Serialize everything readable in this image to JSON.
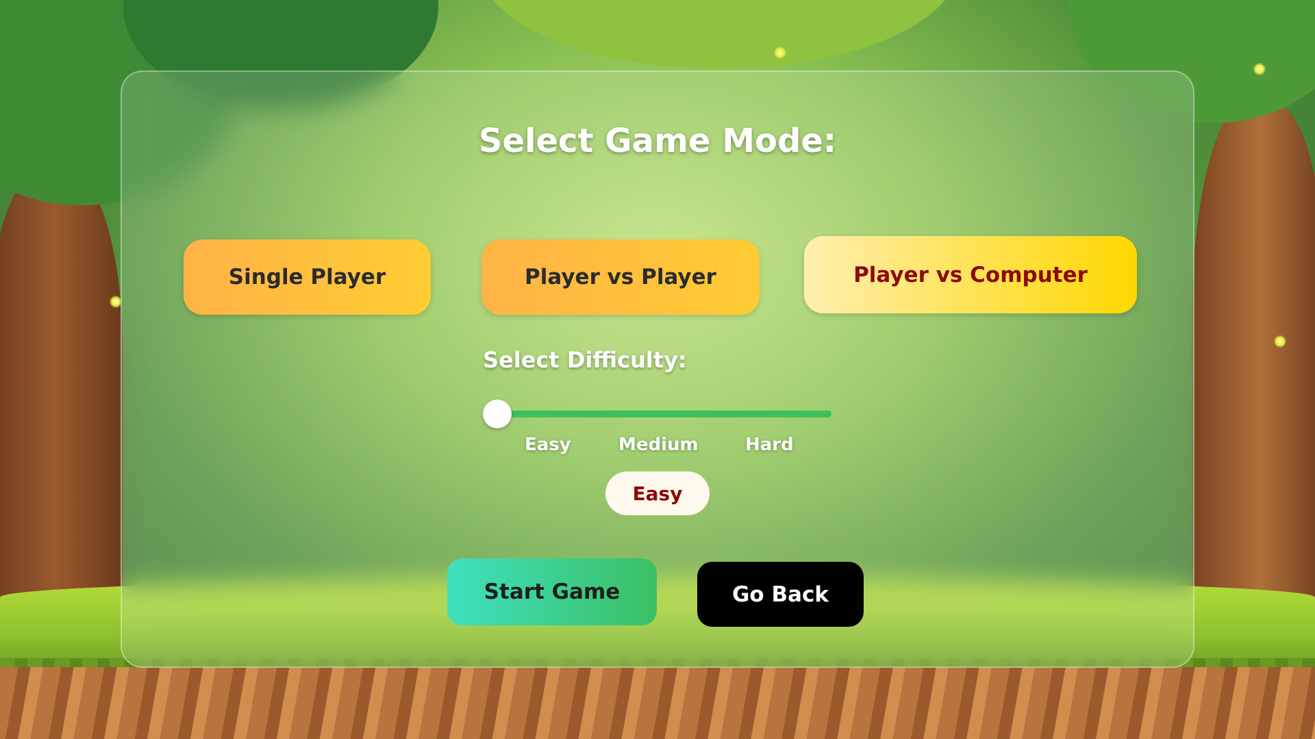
{
  "title": "Select Game Mode:",
  "modes": [
    {
      "label": "Single Player",
      "active": false
    },
    {
      "label": "Player vs Player",
      "active": false
    },
    {
      "label": "Player vs Computer",
      "active": true
    }
  ],
  "difficulty": {
    "heading": "Select Difficulty:",
    "options": [
      "Easy",
      "Medium",
      "Hard"
    ],
    "selected": "Easy",
    "slider_value": 0
  },
  "actions": {
    "start_label": "Start Game",
    "back_label": "Go Back"
  },
  "colors": {
    "mode_button_gradient": [
      "#ffb347",
      "#ffcc33"
    ],
    "active_mode_text": "#8b0a0a",
    "slider_track": "#3fbf5a",
    "start_gradient": [
      "#3ee0c0",
      "#3cbf62"
    ],
    "back_bg": "#000000"
  }
}
